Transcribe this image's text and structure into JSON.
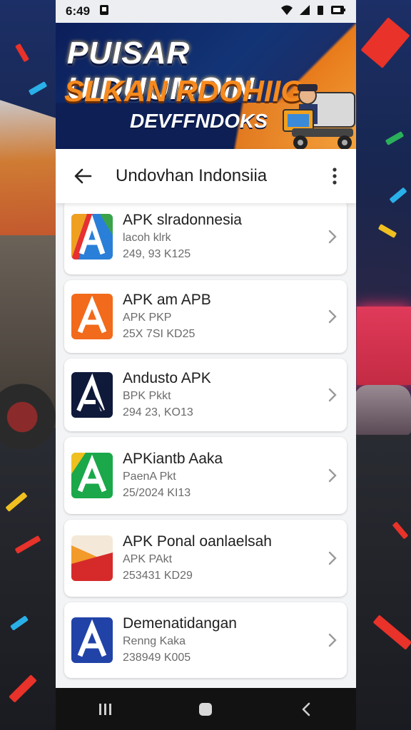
{
  "status_bar": {
    "time": "6:49",
    "icons": [
      "notification-icon",
      "wifi-icon",
      "signal-icon",
      "sim-icon",
      "battery-icon"
    ]
  },
  "banner": {
    "line1": "PUISAR UIDUUMOIN",
    "line2": "SLKAN RDOHIIG",
    "line3": "DEVFFNDOKS"
  },
  "app_bar": {
    "title": "Undovhan Indonsiia",
    "back_icon": "arrow-back-icon",
    "menu_icon": "more-vert-icon"
  },
  "apps": [
    {
      "name": "APK slradonnesia",
      "subtitle": "lacoh klrk",
      "meta": "249, 93 K125",
      "icon": "multicolor-a-logo",
      "colors": [
        "#f0a020",
        "#e83030",
        "#2a7fd8",
        "#3aa34a"
      ]
    },
    {
      "name": "APK am APB",
      "subtitle": "APK PKP",
      "meta": "25X 7SI KD25",
      "icon": "orange-a-logo",
      "colors": [
        "#f26a1b",
        "#ffffff"
      ]
    },
    {
      "name": "Andusto APK",
      "subtitle": "BPK Pkkt",
      "meta": "294 23, KO13",
      "icon": "navy-a-logo",
      "colors": [
        "#0f1a3a",
        "#ffffff"
      ]
    },
    {
      "name": "APKiantb Aaka",
      "subtitle": "PaenA Pkt",
      "meta": "25/2024 KI13",
      "icon": "green-a-logo",
      "colors": [
        "#1aa84a",
        "#ffffff"
      ]
    },
    {
      "name": "APK Ponal oanlaelsah",
      "subtitle": "APK PAkt",
      "meta": "253431 KD29",
      "icon": "red-orange-logo",
      "colors": [
        "#d62a2a",
        "#f29a2a"
      ]
    },
    {
      "name": "Demenatidangan",
      "subtitle": "Renng Kaka",
      "meta": "238949 K005",
      "icon": "blue-a-logo",
      "colors": [
        "#2143a8",
        "#ffffff"
      ]
    }
  ],
  "nav_bar": {
    "icons": [
      "recents-icon",
      "home-icon",
      "back-nav-icon"
    ]
  }
}
